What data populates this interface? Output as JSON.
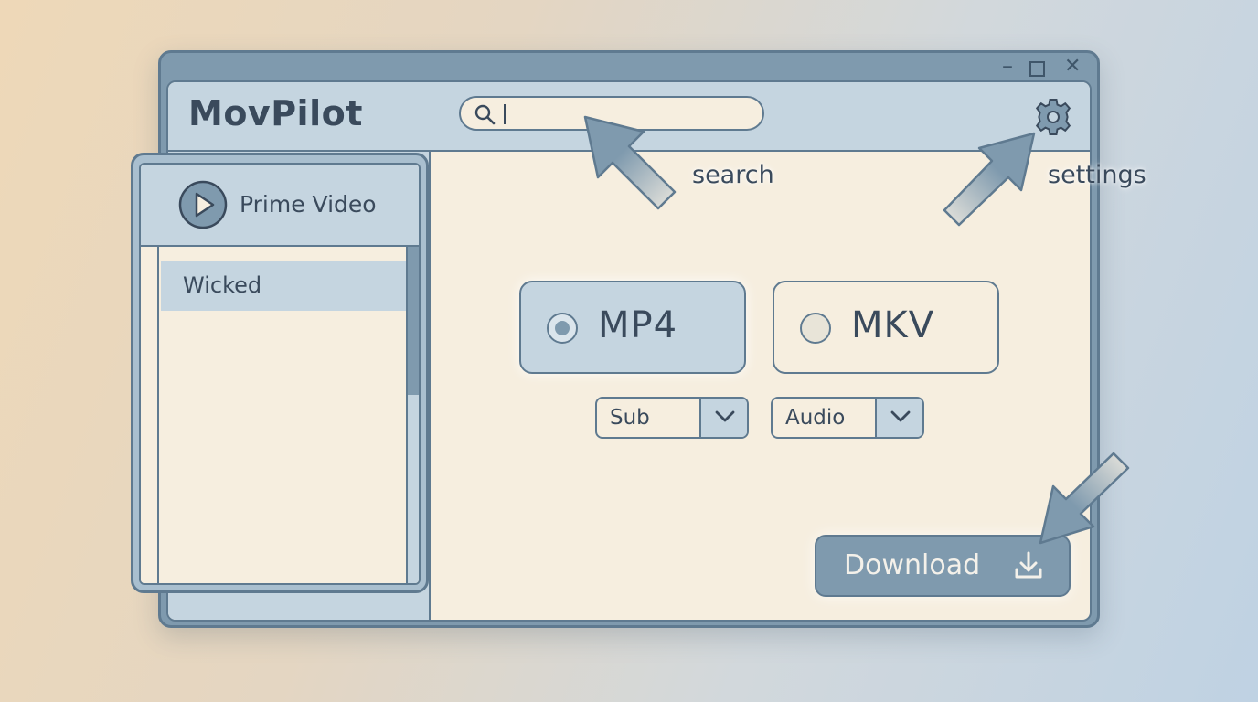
{
  "app": {
    "title": "MovPilot"
  },
  "window_controls": {
    "minimize": "–",
    "close": "✕"
  },
  "search": {
    "value": "",
    "placeholder": "",
    "icon": "search-icon"
  },
  "settings": {
    "icon": "gear-icon"
  },
  "source_panel": {
    "title": "Prime Video",
    "icon": "play-icon",
    "items": [
      {
        "label": "Wicked",
        "selected": true
      }
    ]
  },
  "formats": {
    "options": [
      {
        "label": "MP4",
        "selected": true
      },
      {
        "label": "MKV",
        "selected": false
      }
    ]
  },
  "dropdowns": {
    "subtitle": {
      "label": "Sub"
    },
    "audio": {
      "label": "Audio"
    }
  },
  "download": {
    "label": "Download",
    "icon": "download-icon"
  },
  "callouts": {
    "search": "search",
    "settings": "settings"
  },
  "colors": {
    "accent": "#7f9aae",
    "border": "#5f7a90",
    "panel_light": "#c5d5e0",
    "content_bg": "#f6eedf",
    "text": "#3a4a5c"
  }
}
